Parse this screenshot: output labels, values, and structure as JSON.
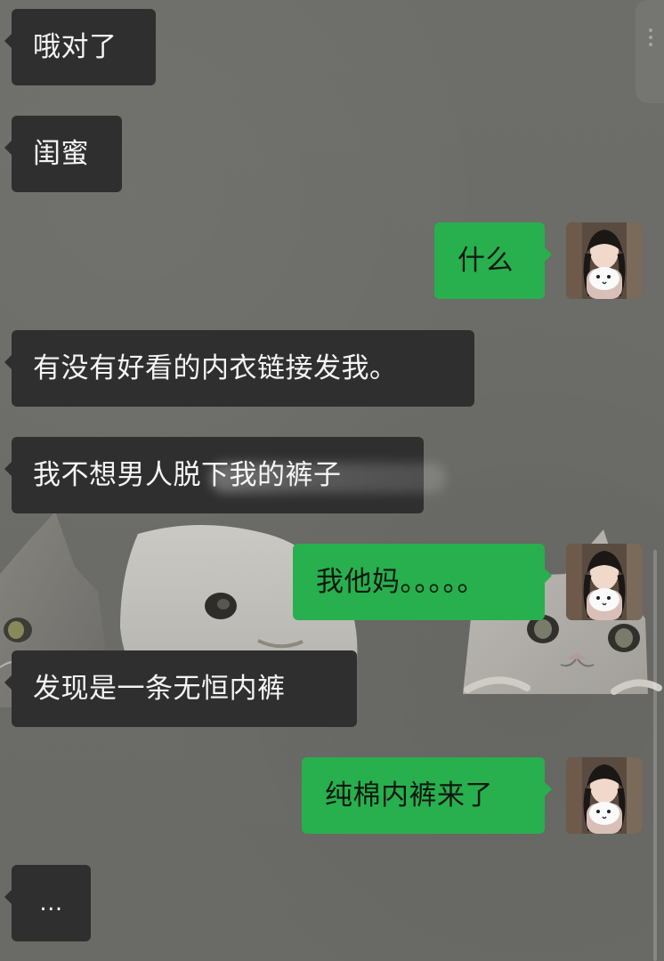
{
  "chat": {
    "messages": [
      {
        "side": "incoming",
        "text": "哦对了"
      },
      {
        "side": "incoming",
        "text": "闺蜜"
      },
      {
        "side": "outgoing",
        "text": "什么"
      },
      {
        "side": "incoming",
        "text": "有没有好看的内衣链接发我。"
      },
      {
        "side": "incoming",
        "text": "我不想男人脱下我的裤子"
      },
      {
        "side": "outgoing",
        "text": "我他妈。。。。。"
      },
      {
        "side": "incoming",
        "text": "发现是一条无恒内裤"
      },
      {
        "side": "outgoing",
        "text": "纯棉内裤来了"
      },
      {
        "side": "incoming",
        "text": "..."
      }
    ]
  },
  "ui": {
    "avatar_icon": "user-avatar",
    "scroll_icon": "vertical-dots-icon"
  },
  "colors": {
    "incoming_bubble": "#2f2f2f",
    "outgoing_bubble": "#27b04d",
    "background": "#6b6b67"
  }
}
